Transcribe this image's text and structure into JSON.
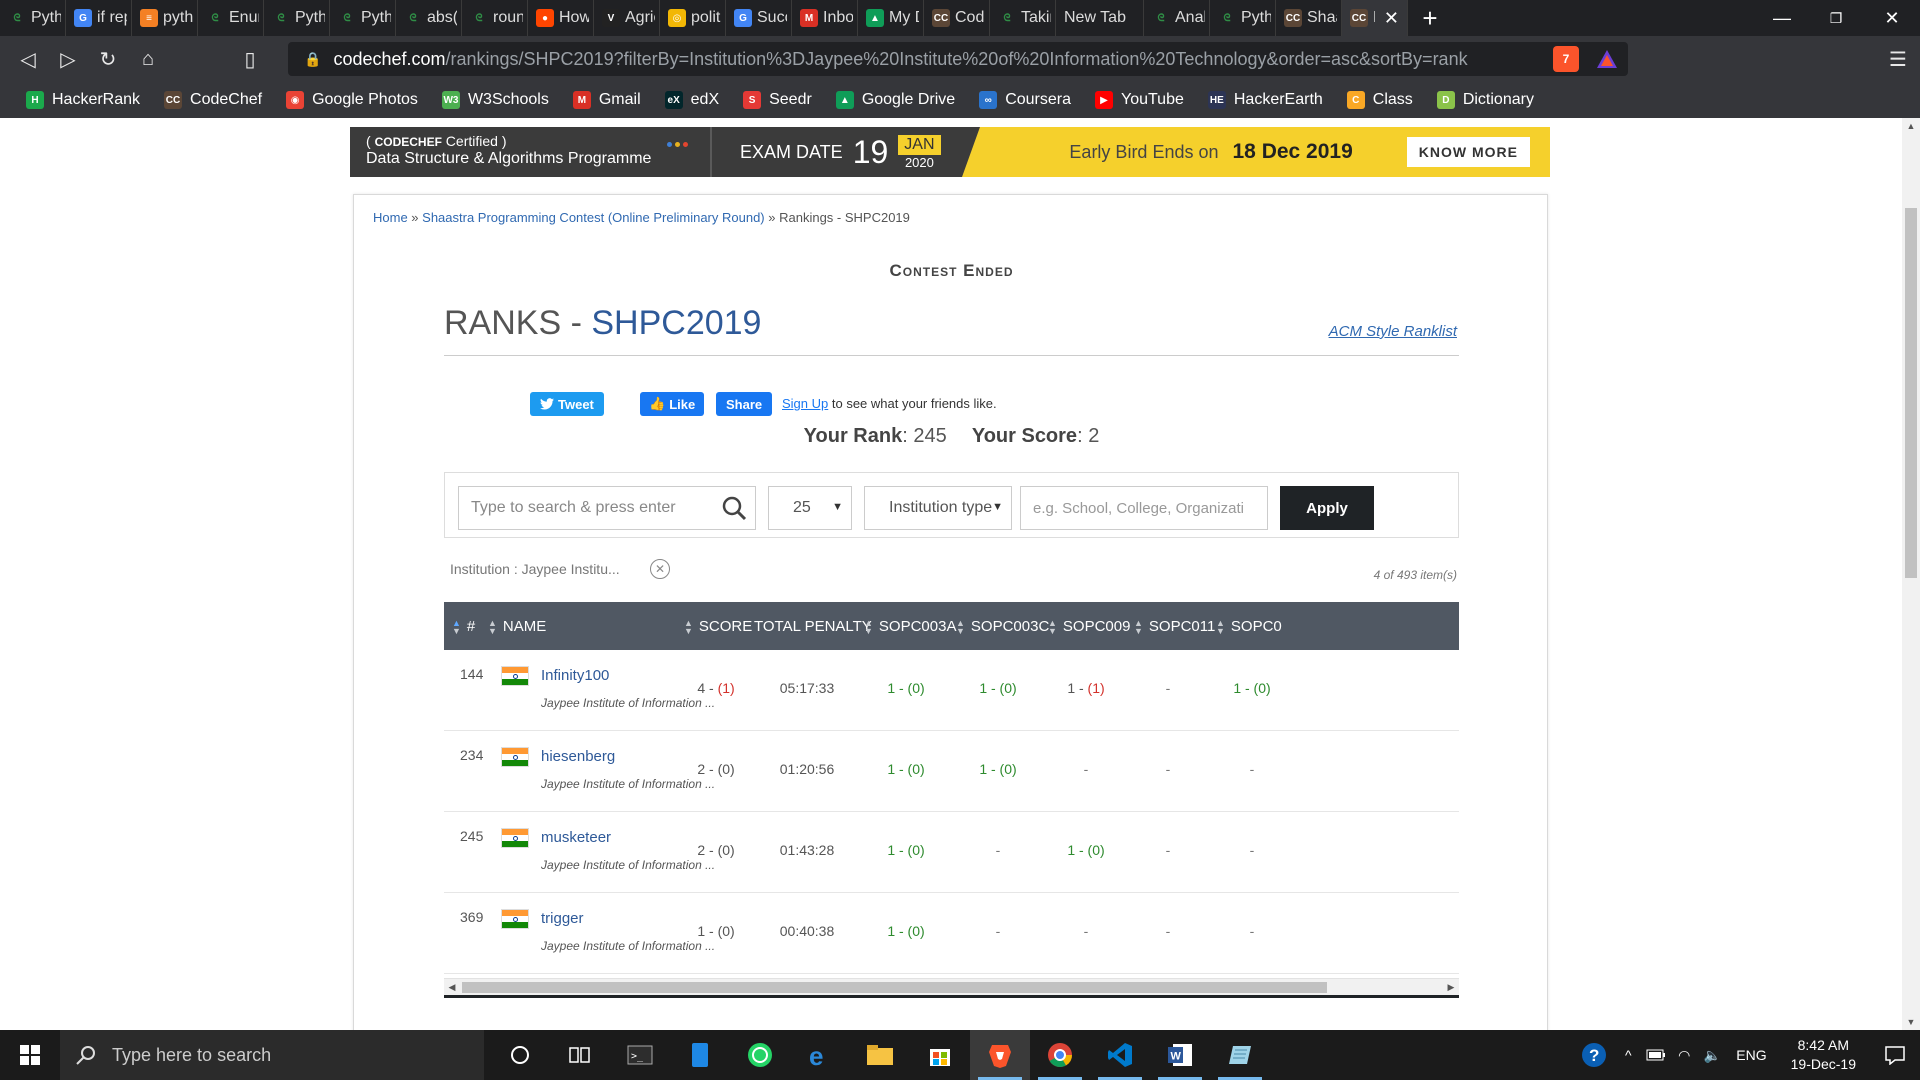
{
  "browser": {
    "tabs": [
      {
        "label": "Pytho",
        "icon": "gfg",
        "color": "#2f8d46"
      },
      {
        "label": "if repl",
        "icon": "google",
        "color": "#4285f4"
      },
      {
        "label": "pytho",
        "icon": "stackoverflow",
        "color": "#f48024"
      },
      {
        "label": "Enum",
        "icon": "gfg",
        "color": "#2f8d46"
      },
      {
        "label": "Pytho",
        "icon": "gfg",
        "color": "#2f8d46"
      },
      {
        "label": "Pytho",
        "icon": "gfg",
        "color": "#2f8d46"
      },
      {
        "label": "abs()",
        "icon": "gfg",
        "color": "#2f8d46"
      },
      {
        "label": "round",
        "icon": "gfg",
        "color": "#2f8d46"
      },
      {
        "label": "How t",
        "icon": "reddit",
        "color": "#ff4500"
      },
      {
        "label": "Agric",
        "icon": "vision",
        "color": "#222222"
      },
      {
        "label": "politi",
        "icon": "circle",
        "color": "#f2b705"
      },
      {
        "label": "Succe",
        "icon": "google",
        "color": "#4285f4"
      },
      {
        "label": "Inbox",
        "icon": "gmail",
        "color": "#d93025"
      },
      {
        "label": "My D",
        "icon": "drive",
        "color": "#0f9d58"
      },
      {
        "label": "Code",
        "icon": "codechef",
        "color": "#5b4636"
      },
      {
        "label": "Takin",
        "icon": "gfg",
        "color": "#2f8d46"
      },
      {
        "label": "New Tab",
        "icon": "none",
        "color": "#202124"
      },
      {
        "label": "Analy",
        "icon": "gfg",
        "color": "#2f8d46"
      },
      {
        "label": "Pytho",
        "icon": "gfg",
        "color": "#2f8d46"
      },
      {
        "label": "Shaas",
        "icon": "codechef",
        "color": "#5b4636"
      },
      {
        "label": "Ra",
        "icon": "codechef",
        "color": "#5b4636",
        "active": true
      }
    ],
    "url_host": "codechef.com",
    "url_path": "/rankings/SHPC2019?filterBy=Institution%3DJaypee%20Institute%20of%20Information%20Technology&order=asc&sortBy=rank",
    "shield_count": "7",
    "bookmarks": [
      {
        "label": "HackerRank",
        "color": "#1ba94c",
        "glyph": "H"
      },
      {
        "label": "CodeChef",
        "color": "#5b4636",
        "glyph": "CC"
      },
      {
        "label": "Google Photos",
        "color": "#ea4335",
        "glyph": "◉"
      },
      {
        "label": "W3Schools",
        "color": "#4caf50",
        "glyph": "W3"
      },
      {
        "label": "Gmail",
        "color": "#d93025",
        "glyph": "M"
      },
      {
        "label": "edX",
        "color": "#02262b",
        "glyph": "eX"
      },
      {
        "label": "Seedr",
        "color": "#e53935",
        "glyph": "S"
      },
      {
        "label": "Google Drive",
        "color": "#0f9d58",
        "glyph": "▲"
      },
      {
        "label": "Coursera",
        "color": "#2a73cc",
        "glyph": "∞"
      },
      {
        "label": "YouTube",
        "color": "#ff0000",
        "glyph": "▶"
      },
      {
        "label": "HackerEarth",
        "color": "#2c3454",
        "glyph": "HE"
      },
      {
        "label": "Class",
        "color": "#f9a825",
        "glyph": "C"
      },
      {
        "label": "Dictionary",
        "color": "#8bc34a",
        "glyph": "D"
      }
    ]
  },
  "banner": {
    "brand": "CODECHEF",
    "certified": "Certified",
    "program": "Data Structure & Algorithms Programme",
    "exam_label": "EXAM DATE",
    "exam_day": "19",
    "exam_month": "JAN",
    "exam_year": "2020",
    "early_bird": "Early Bird Ends on",
    "early_date": "18 Dec 2019",
    "know_more": "KNOW MORE"
  },
  "breadcrumb": {
    "home": "Home",
    "sep": " » ",
    "contest": "Shaastra Programming Contest (Online Preliminary Round)",
    "current": "Rankings - SHPC2019"
  },
  "contest_status": "Contest Ended",
  "ranks": {
    "title": "RANKS - ",
    "code": "SHPC2019",
    "acm_link": "ACM Style Ranklist"
  },
  "social": {
    "tweet": "Tweet",
    "like": "Like",
    "share": "Share",
    "signup": "Sign Up",
    "signup_rest": " to see what your friends like."
  },
  "user_stats": {
    "rank_label": "Your Rank",
    "rank": "245",
    "score_label": "Your Score",
    "score": "2"
  },
  "filters": {
    "search_placeholder": "Type to search & press enter",
    "page_size": "25",
    "institution_type": "Institution type",
    "institution_placeholder": "e.g. School, College, Organizati",
    "apply": "Apply",
    "active_filter": "Institution : Jaypee Institu...",
    "item_count": "4 of 493 item(s)"
  },
  "table": {
    "columns": [
      "#",
      "NAME",
      "SCORE",
      "TOTAL PENALTY",
      "SOPC003A",
      "SOPC003C",
      "SOPC009",
      "SOPC011",
      "SOPC0"
    ],
    "rows": [
      {
        "rank": "144",
        "name": "Infinity100",
        "inst": "Jaypee Institute of Information ...",
        "score": "4",
        "score_pen": "(1)",
        "penalty": "05:17:33",
        "p1": "1 - (0)",
        "p1c": "green",
        "p2": "1 - (0)",
        "p2c": "green",
        "p3a": "1 - ",
        "p3b": "(1)",
        "p4": "-",
        "p5": "1 - (0)",
        "p5c": "green"
      },
      {
        "rank": "234",
        "name": "hiesenberg",
        "inst": "Jaypee Institute of Information ...",
        "score": "2",
        "score_pen": "(0)",
        "penalty": "01:20:56",
        "p1": "1 - (0)",
        "p1c": "green",
        "p2": "1 - (0)",
        "p2c": "green",
        "p3a": "-",
        "p3b": "",
        "p4": "-",
        "p5": "-",
        "p5c": "gray"
      },
      {
        "rank": "245",
        "name": "musketeer",
        "inst": "Jaypee Institute of Information ...",
        "score": "2",
        "score_pen": "(0)",
        "penalty": "01:43:28",
        "p1": "1 - (0)",
        "p1c": "green",
        "p2": "-",
        "p2c": "gray",
        "p3a": "1 - (0)",
        "p3b": "",
        "p4": "-",
        "p5": "-",
        "p5c": "gray"
      },
      {
        "rank": "369",
        "name": "trigger",
        "inst": "Jaypee Institute of Information ...",
        "score": "1",
        "score_pen": "(0)",
        "penalty": "00:40:38",
        "p1": "1 - (0)",
        "p1c": "green",
        "p2": "-",
        "p2c": "gray",
        "p3a": "-",
        "p3b": "",
        "p4": "-",
        "p5": "-",
        "p5c": "gray"
      }
    ]
  },
  "taskbar": {
    "search_placeholder": "Type here to search",
    "language": "ENG",
    "time": "8:42 AM",
    "date": "19-Dec-19"
  }
}
